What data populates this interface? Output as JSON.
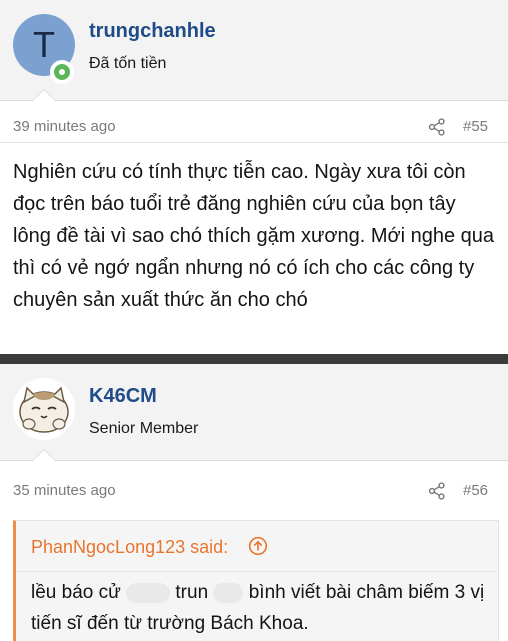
{
  "posts": [
    {
      "avatar_letter": "T",
      "username": "trungchanhle",
      "user_title": "Đã tốn tiền",
      "time": "39 minutes ago",
      "post_number": "#55",
      "body": "Nghiên cứu có tính thực tiễn cao. Ngày xưa tôi còn đọc trên báo tuổi trẻ đăng nghiên cứu của bọn tây lông đề tài vì sao chó thích gặm xương. Mới nghe qua thì có vẻ ngớ ngẩn nhưng nó có ích cho các công ty chuyên sản xuất thức ăn cho chó"
    },
    {
      "username": "K46CM",
      "user_title": "Senior Member",
      "time": "35 minutes ago",
      "post_number": "#56",
      "quote": {
        "author_said": "PhanNgocLong123 said:",
        "text_part1": "lều báo cử",
        "text_part2": "trun",
        "text_part3": "bình viết bài châm biếm 3 vị tiến sĩ đến từ trường Bách Khoa."
      }
    }
  ],
  "colors": {
    "username": "#1f4b89",
    "quote_accent": "#e8752e",
    "avatar_bg": "#7aa1cf",
    "online": "#5ab65a"
  }
}
